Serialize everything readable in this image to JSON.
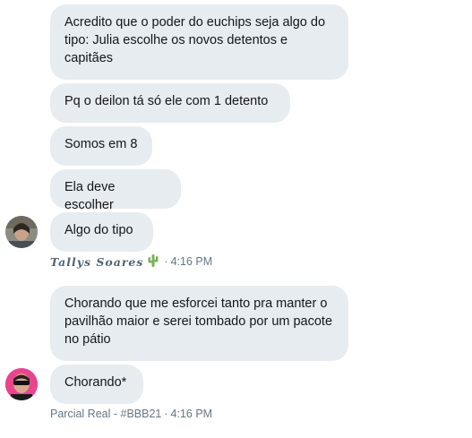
{
  "group1": {
    "messages": [
      "Acredito que o poder do euchips seja algo do tipo: Julia escolhe os novos detentos e capitães",
      "Pq o deilon tá só ele com 1 detento",
      "Somos em 8",
      "Ela deve escolher",
      "Algo do tipo"
    ],
    "sender": "Tallys Soares",
    "sender_emoji": "cactus-icon",
    "separator": "·",
    "time": "4:16 PM"
  },
  "group2": {
    "messages": [
      "Chorando que me esforcei tanto pra manter o pavilhão maior e serei tombado por um pacote no pátio",
      "Chorando*"
    ],
    "sender": "Parcial Real - #BBB21",
    "separator": "·",
    "time": "4:16 PM"
  },
  "colors": {
    "bubble_bg": "#e6ecf0",
    "meta_text": "#657786",
    "avatar2_bg": "#e8458f"
  }
}
